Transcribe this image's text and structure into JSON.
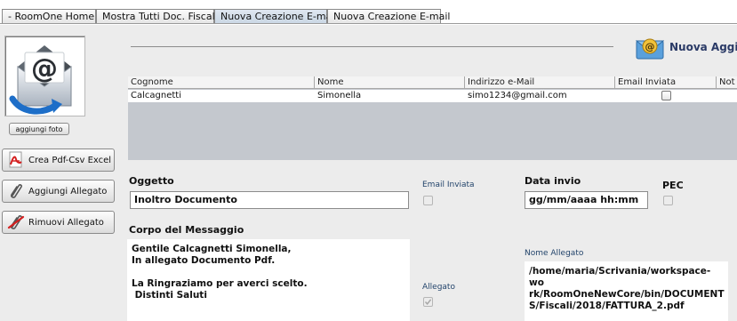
{
  "tabs": [
    {
      "label": "- RoomOne Home -",
      "active": false
    },
    {
      "label": "Mostra Tutti Doc. Fiscale",
      "active": false
    },
    {
      "label": "Nuova Creazione E-mail",
      "active": true
    },
    {
      "label": "Nuova Creazione E-mail",
      "active": false
    }
  ],
  "sidebar": {
    "photo_icon": "email-at-icon",
    "add_photo_label": "aggiungi foto",
    "buttons": [
      {
        "label": "Crea Pdf-Csv Excel",
        "icon": "pdf-icon"
      },
      {
        "label": "Aggiungi Allegato",
        "icon": "paperclip-icon"
      },
      {
        "label": "Rimuovi Allegato",
        "icon": "remove-paperclip-icon"
      }
    ]
  },
  "header": {
    "title": "Nuova Aggiu",
    "icon": "email-at-icon"
  },
  "table": {
    "columns": [
      "Cognome",
      "Nome",
      "Indirizzo e-Mail",
      "Email Inviata",
      "Not"
    ],
    "rows": [
      {
        "cognome": "Calcagnetti",
        "nome": "Simonella",
        "email": "simo1234@gmail.com",
        "inviata": false
      }
    ]
  },
  "form": {
    "oggetto_label": "Oggetto",
    "oggetto_value": "Inoltro Documento",
    "email_inviata_label": "Email Inviata",
    "email_inviata_checked": false,
    "data_invio_label": "Data invio",
    "data_invio_value": "gg/mm/aaaa hh:mm",
    "pec_label": "PEC",
    "pec_checked": false,
    "corpo_label": "Corpo del Messaggio",
    "corpo_value": "Gentile Calcagnetti Simonella,\nIn allegato Documento Pdf.\n\nLa Ringraziamo per averci scelto.\n Distinti Saluti",
    "allegato_label": "Allegato",
    "allegato_checked": true,
    "nome_allegato_label": "Nome Allegato",
    "nome_allegato_value": "/home/maria/Scrivania/workspace-wo\nrk/RoomOneNewCore/bin/DOCUMENT\nS/Fiscali/2018/FATTURA_2.pdf"
  },
  "colors": {
    "header_title": "#2a3a66",
    "small_label": "#23446b",
    "table_empty": "#c4c8ce"
  }
}
